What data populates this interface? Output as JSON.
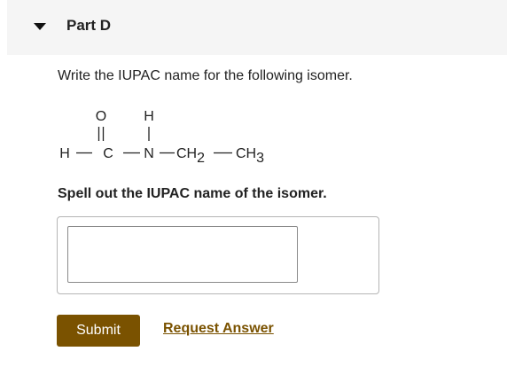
{
  "part": {
    "title": "Part D",
    "collapse_icon": "caret-down-icon"
  },
  "question": {
    "prompt": "Write the IUPAC name for the following isomer."
  },
  "structure": {
    "atoms": {
      "h_left": "H",
      "c": "C",
      "o": "O",
      "n": "N",
      "h_top": "H",
      "ch2_main": "CH",
      "ch2_sub": "2",
      "ch3_main": "CH",
      "ch3_sub": "3"
    }
  },
  "instruction": "Spell out the IUPAC name of the isomer.",
  "answer": {
    "value": "",
    "placeholder": ""
  },
  "actions": {
    "submit_label": "Submit",
    "request_label": "Request Answer"
  },
  "colors": {
    "accent": "#7a5200",
    "header_bg": "#f5f5f5"
  }
}
